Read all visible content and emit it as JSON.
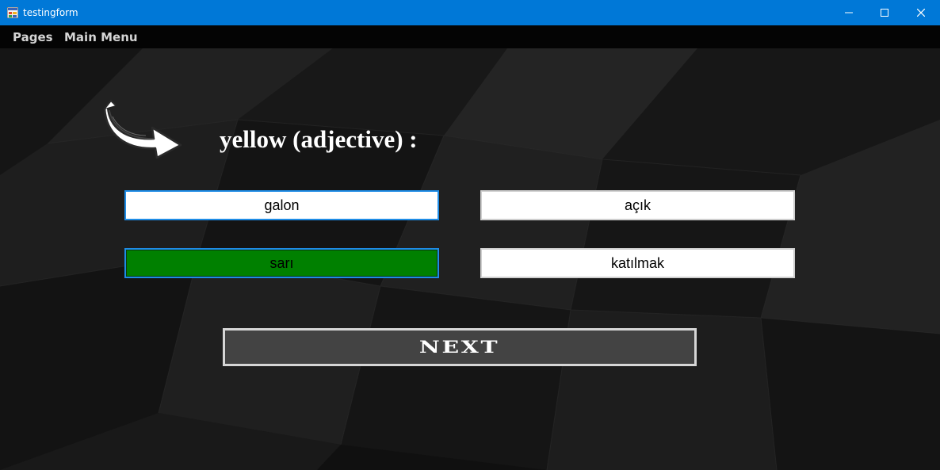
{
  "window": {
    "title": "testingform",
    "controls": [
      "minimize-icon",
      "maximize-icon",
      "close-icon"
    ]
  },
  "menu": {
    "items": [
      {
        "label": "Pages"
      },
      {
        "label": "Main Menu"
      }
    ]
  },
  "quiz": {
    "question": "yellow (adjective) :",
    "answers": [
      {
        "label": "galon",
        "state": "focused"
      },
      {
        "label": "açık",
        "state": "default"
      },
      {
        "label": "sarı",
        "state": "correct"
      },
      {
        "label": "katılmak",
        "state": "default"
      }
    ],
    "next_label": "NEXT",
    "pointer_icon": "curved-arrow-icon"
  },
  "colors": {
    "titlebar": "#0078d7",
    "menubar": "#040404",
    "background": "#1c1c1c",
    "answer_bg": "#ffffff",
    "correct_bg": "#008000",
    "focus_border": "#1e8ce6",
    "next_bg": "#434343",
    "next_border": "#d6d6d6"
  }
}
